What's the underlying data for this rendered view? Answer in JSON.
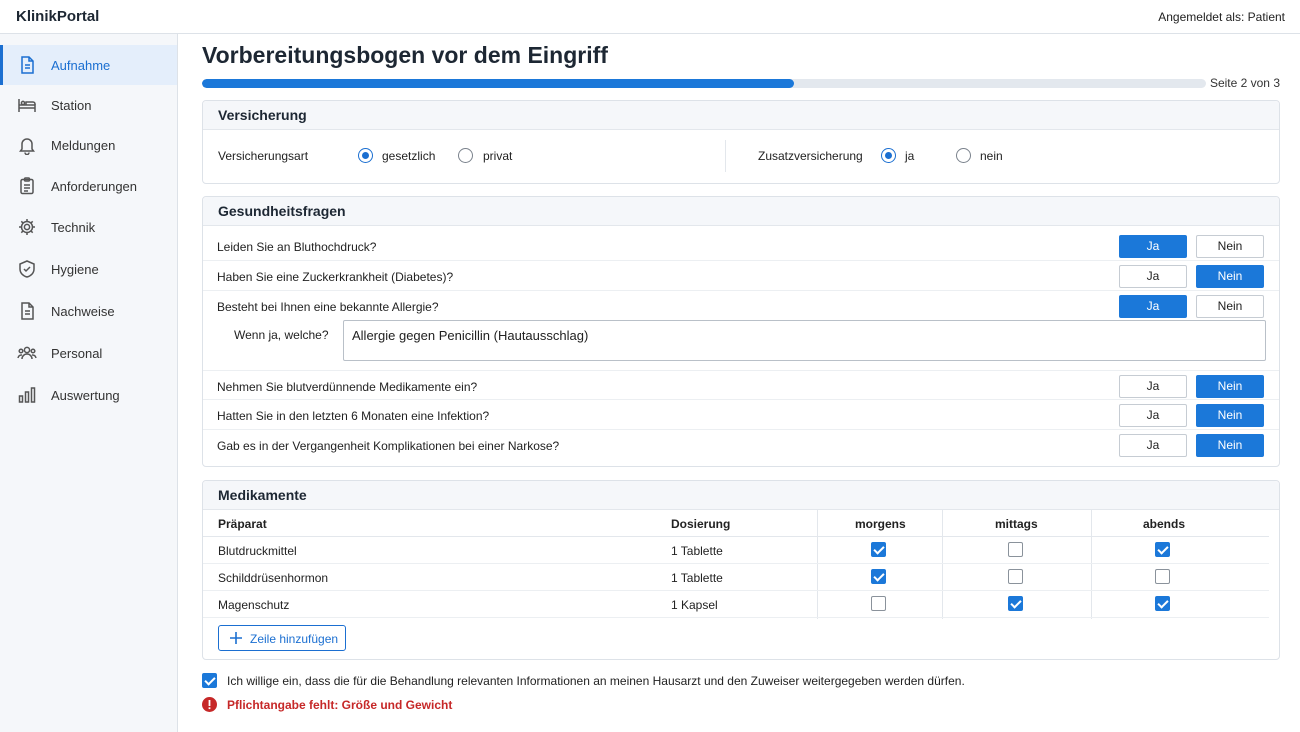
{
  "app": {
    "brand": "KlinikPortal",
    "user": "Angemeldet als: Patient"
  },
  "sidebar": {
    "items": [
      {
        "label": "Aufnahme",
        "icon": "document-icon",
        "active": true
      },
      {
        "label": "Station",
        "icon": "bed-icon",
        "active": false
      },
      {
        "label": "Meldungen",
        "icon": "bell-icon",
        "active": false
      },
      {
        "label": "Anforderungen",
        "icon": "clipboard-icon",
        "active": false
      },
      {
        "label": "Technik",
        "icon": "gear-icon",
        "active": false
      },
      {
        "label": "Hygiene",
        "icon": "shield-icon",
        "active": false
      },
      {
        "label": "Nachweise",
        "icon": "file-icon",
        "active": false
      },
      {
        "label": "Personal",
        "icon": "people-icon",
        "active": false
      },
      {
        "label": "Auswertung",
        "icon": "bar-chart-icon",
        "active": false
      }
    ]
  },
  "page": {
    "title": "Vorbereitungsbogen vor dem Eingriff",
    "progress_fraction": 0.59,
    "page_indicator": "Seite 2 von 3"
  },
  "versicherung": {
    "title": "Versicherung",
    "art_label": "Versicherungsart",
    "art_options": [
      "gesetzlich",
      "privat"
    ],
    "art_selected": "gesetzlich",
    "zusatz_label": "Zusatzversicherung",
    "zusatz_options": [
      "ja",
      "nein"
    ],
    "zusatz_selected": "ja"
  },
  "gesundheit": {
    "title": "Gesundheitsfragen",
    "yes_label": "Ja",
    "no_label": "Nein",
    "questions": [
      {
        "text": "Leiden Sie an Bluthochdruck?",
        "answer": "Ja"
      },
      {
        "text": "Haben Sie eine Zuckerkrankheit (Diabetes)?",
        "answer": "Nein"
      },
      {
        "text": "Besteht bei Ihnen eine bekannte Allergie?",
        "answer": "Ja"
      },
      {
        "text": "Nehmen Sie blutverdünnende Medikamente ein?",
        "answer": "Nein"
      },
      {
        "text": "Hatten Sie in den letzten 6 Monaten eine Infektion?",
        "answer": "Nein"
      },
      {
        "text": "Gab es in der Vergangenheit Komplikationen bei einer Narkose?",
        "answer": "Nein"
      }
    ],
    "allergy_label": "Wenn ja, welche?",
    "allergy_value": "Allergie gegen Penicillin (Hautausschlag)"
  },
  "medikamente": {
    "title": "Medikamente",
    "columns": [
      "Präparat",
      "Dosierung",
      "morgens",
      "mittags",
      "abends"
    ],
    "rows": [
      {
        "praeparat": "Blutdruckmittel",
        "dosierung": "1 Tablette",
        "morgens": true,
        "mittags": false,
        "abends": true
      },
      {
        "praeparat": "Schilddrüsenhormon",
        "dosierung": "1 Tablette",
        "morgens": true,
        "mittags": false,
        "abends": false
      },
      {
        "praeparat": "Magenschutz",
        "dosierung": "1 Kapsel",
        "morgens": false,
        "mittags": true,
        "abends": true
      }
    ],
    "add_label": "Zeile hinzufügen"
  },
  "consent": {
    "checked": true,
    "text": "Ich willige ein, dass die für die Behandlung relevanten Informationen an meinen Hausarzt und den Zuweiser weitergegeben werden dürfen."
  },
  "error": {
    "text": "Pflichtangabe fehlt: Größe und Gewicht"
  },
  "colors": {
    "accent": "#1b78d9",
    "error": "#c62828"
  }
}
